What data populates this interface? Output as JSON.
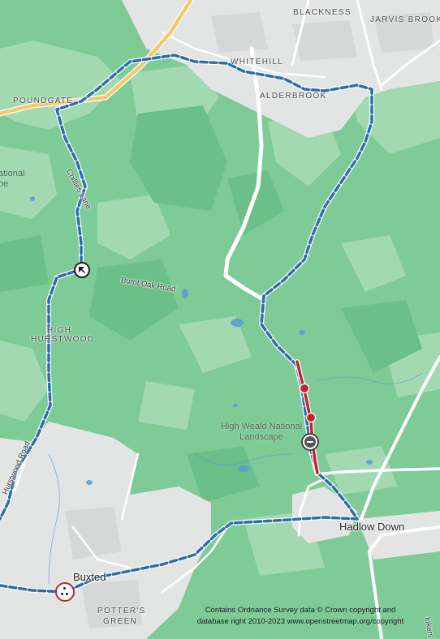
{
  "map": {
    "labels": {
      "blackness": "BLACKNESS",
      "jarvis_brook": "JARVIS BROOK",
      "whitehill": "WHITEHILL",
      "alderbrook": "ALDERBROOK",
      "poundgate": "POUNDGATE",
      "national_cut": "ational",
      "national_cut2": "pe",
      "chillies_lane": "Chillies Lane",
      "burnt_oak_road": "Burnt Oak Road",
      "high": "HIGH",
      "hurstwood": "HURSTWOOD",
      "hurstwood_road": "Hurstwood Road",
      "high_weald_1": "High Weald National",
      "high_weald_2": "Landscape",
      "hadlow_down": "Hadlow Down",
      "buxted": "Buxted",
      "potters": "POTTER'S",
      "green": "GREEN",
      "road_cut": "lokers La"
    },
    "attribution": {
      "line1": "Contains Ordnance Survey data © Crown copyright and",
      "line2": "database right 2010-2023 www.openstreetmap.org/copyright"
    },
    "colors": {
      "woodland": "#7fcb98",
      "meadow": "#a2d9b1",
      "urban": "#e2e5e3",
      "road": "#ffffff",
      "a_road": "#f2c96b",
      "route_dashed": "#2d6cae",
      "route_highlight": "#c0262c",
      "water": "#5b9ad6"
    },
    "icons": {
      "direction_marker": "arrow-up-left-icon",
      "stop_marker": "no-entry-icon",
      "start_marker": "start-end-icon"
    }
  }
}
